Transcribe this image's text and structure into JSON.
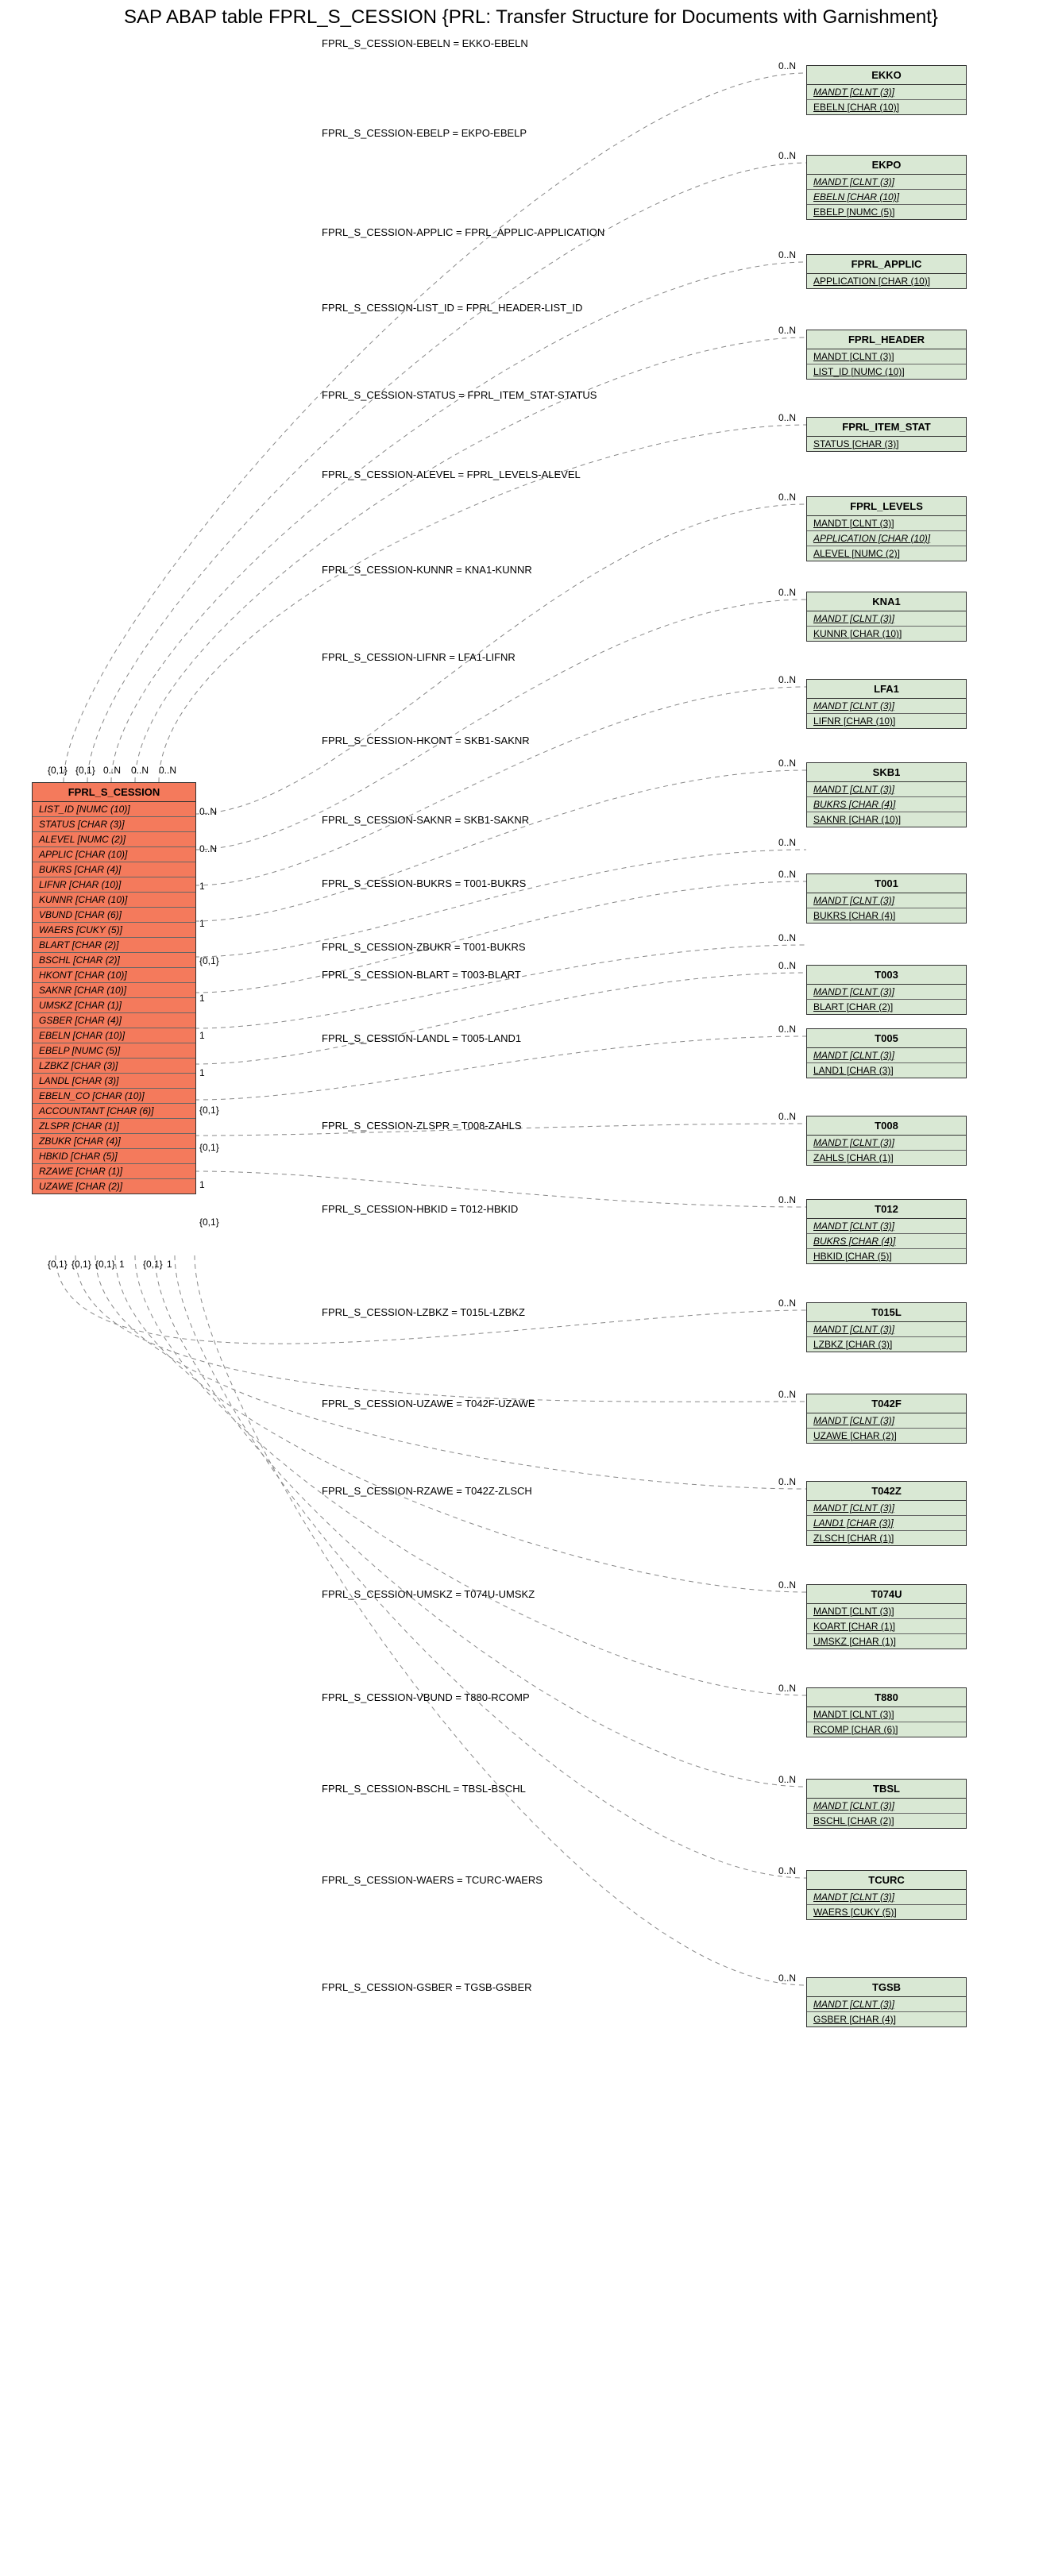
{
  "title": "SAP ABAP table FPRL_S_CESSION {PRL: Transfer Structure for Documents with Garnishment}",
  "main": {
    "name": "FPRL_S_CESSION",
    "fields": [
      {
        "t": "LIST_ID [NUMC (10)]",
        "i": true
      },
      {
        "t": "STATUS [CHAR (3)]",
        "i": true
      },
      {
        "t": "ALEVEL [NUMC (2)]",
        "i": true
      },
      {
        "t": "APPLIC [CHAR (10)]",
        "i": true
      },
      {
        "t": "BUKRS [CHAR (4)]",
        "i": true
      },
      {
        "t": "LIFNR [CHAR (10)]",
        "i": true
      },
      {
        "t": "KUNNR [CHAR (10)]",
        "i": true
      },
      {
        "t": "VBUND [CHAR (6)]",
        "i": true
      },
      {
        "t": "WAERS [CUKY (5)]",
        "i": true
      },
      {
        "t": "BLART [CHAR (2)]",
        "i": true
      },
      {
        "t": "BSCHL [CHAR (2)]",
        "i": true
      },
      {
        "t": "HKONT [CHAR (10)]",
        "i": true
      },
      {
        "t": "SAKNR [CHAR (10)]",
        "i": true
      },
      {
        "t": "UMSKZ [CHAR (1)]",
        "i": true
      },
      {
        "t": "GSBER [CHAR (4)]",
        "i": true
      },
      {
        "t": "EBELN [CHAR (10)]",
        "i": true
      },
      {
        "t": "EBELP [NUMC (5)]",
        "i": true
      },
      {
        "t": "LZBKZ [CHAR (3)]",
        "i": true
      },
      {
        "t": "LANDL [CHAR (3)]",
        "i": true
      },
      {
        "t": "EBELN_CO [CHAR (10)]",
        "i": true
      },
      {
        "t": "ACCOUNTANT [CHAR (6)]",
        "i": true
      },
      {
        "t": "ZLSPR [CHAR (1)]",
        "i": true
      },
      {
        "t": "ZBUKR [CHAR (4)]",
        "i": true
      },
      {
        "t": "HBKID [CHAR (5)]",
        "i": true
      },
      {
        "t": "RZAWE [CHAR (1)]",
        "i": true
      },
      {
        "t": "UZAWE [CHAR (2)]",
        "i": true
      }
    ],
    "cards_top": [
      "{0,1}",
      "{0,1}",
      "0..N",
      "0..N",
      "0..N"
    ],
    "cards_right_top": [
      "0..N",
      "0..N",
      "1",
      "1",
      "{0,1}",
      "1",
      "1",
      "1",
      "{0,1}",
      "{0,1}",
      "1",
      "{0,1}"
    ],
    "cards_bottom": [
      "{0,1}",
      "{0,1}",
      "{0,1}",
      "1",
      "{0,1}",
      "1"
    ]
  },
  "targets": [
    {
      "name": "EKKO",
      "fields": [
        {
          "t": "MANDT [CLNT (3)]",
          "u": true,
          "i": true
        },
        {
          "t": "EBELN [CHAR (10)]",
          "u": true
        }
      ],
      "join": "FPRL_S_CESSION-EBELN = EKKO-EBELN",
      "card": "0..N"
    },
    {
      "name": "EKPO",
      "fields": [
        {
          "t": "MANDT [CLNT (3)]",
          "u": true,
          "i": true
        },
        {
          "t": "EBELN [CHAR (10)]",
          "u": true,
          "i": true
        },
        {
          "t": "EBELP [NUMC (5)]",
          "u": true
        }
      ],
      "join": "FPRL_S_CESSION-EBELP = EKPO-EBELP",
      "card": "0..N"
    },
    {
      "name": "FPRL_APPLIC",
      "fields": [
        {
          "t": "APPLICATION [CHAR (10)]",
          "u": true
        }
      ],
      "join": "FPRL_S_CESSION-APPLIC = FPRL_APPLIC-APPLICATION",
      "card": "0..N"
    },
    {
      "name": "FPRL_HEADER",
      "fields": [
        {
          "t": "MANDT [CLNT (3)]",
          "u": true
        },
        {
          "t": "LIST_ID [NUMC (10)]",
          "u": true
        }
      ],
      "join": "FPRL_S_CESSION-LIST_ID = FPRL_HEADER-LIST_ID",
      "card": "0..N"
    },
    {
      "name": "FPRL_ITEM_STAT",
      "fields": [
        {
          "t": "STATUS [CHAR (3)]",
          "u": true
        }
      ],
      "join": "FPRL_S_CESSION-STATUS = FPRL_ITEM_STAT-STATUS",
      "card": "0..N"
    },
    {
      "name": "FPRL_LEVELS",
      "fields": [
        {
          "t": "MANDT [CLNT (3)]",
          "u": true
        },
        {
          "t": "APPLICATION [CHAR (10)]",
          "u": true,
          "i": true
        },
        {
          "t": "ALEVEL [NUMC (2)]",
          "u": true
        }
      ],
      "join": "FPRL_S_CESSION-ALEVEL = FPRL_LEVELS-ALEVEL",
      "card": "0..N"
    },
    {
      "name": "KNA1",
      "fields": [
        {
          "t": "MANDT [CLNT (3)]",
          "u": true,
          "i": true
        },
        {
          "t": "KUNNR [CHAR (10)]",
          "u": true
        }
      ],
      "join": "FPRL_S_CESSION-KUNNR = KNA1-KUNNR",
      "card": "0..N"
    },
    {
      "name": "LFA1",
      "fields": [
        {
          "t": "MANDT [CLNT (3)]",
          "u": true,
          "i": true
        },
        {
          "t": "LIFNR [CHAR (10)]",
          "u": true
        }
      ],
      "join": "FPRL_S_CESSION-LIFNR = LFA1-LIFNR",
      "card": "0..N"
    },
    {
      "name": "SKB1",
      "fields": [
        {
          "t": "MANDT [CLNT (3)]",
          "u": true,
          "i": true
        },
        {
          "t": "BUKRS [CHAR (4)]",
          "u": true,
          "i": true
        },
        {
          "t": "SAKNR [CHAR (10)]",
          "u": true
        }
      ],
      "join": "FPRL_S_CESSION-HKONT = SKB1-SAKNR",
      "card": "0..N"
    },
    {
      "name": "",
      "fields": [],
      "join": "FPRL_S_CESSION-SAKNR = SKB1-SAKNR",
      "card": "0..N"
    },
    {
      "name": "T001",
      "fields": [
        {
          "t": "MANDT [CLNT (3)]",
          "u": true,
          "i": true
        },
        {
          "t": "BUKRS [CHAR (4)]",
          "u": true
        }
      ],
      "join": "FPRL_S_CESSION-BUKRS = T001-BUKRS",
      "card": "0..N"
    },
    {
      "name": "",
      "fields": [],
      "join": "FPRL_S_CESSION-ZBUKR = T001-BUKRS",
      "card": "0..N"
    },
    {
      "name": "T003",
      "fields": [
        {
          "t": "MANDT [CLNT (3)]",
          "u": true,
          "i": true
        },
        {
          "t": "BLART [CHAR (2)]",
          "u": true
        }
      ],
      "join": "FPRL_S_CESSION-BLART = T003-BLART",
      "card": "0..N"
    },
    {
      "name": "T005",
      "fields": [
        {
          "t": "MANDT [CLNT (3)]",
          "u": true,
          "i": true
        },
        {
          "t": "LAND1 [CHAR (3)]",
          "u": true
        }
      ],
      "join": "FPRL_S_CESSION-LANDL = T005-LAND1",
      "card": "0..N"
    },
    {
      "name": "T008",
      "fields": [
        {
          "t": "MANDT [CLNT (3)]",
          "u": true,
          "i": true
        },
        {
          "t": "ZAHLS [CHAR (1)]",
          "u": true
        }
      ],
      "join": "FPRL_S_CESSION-ZLSPR = T008-ZAHLS",
      "card": "0..N"
    },
    {
      "name": "T012",
      "fields": [
        {
          "t": "MANDT [CLNT (3)]",
          "u": true,
          "i": true
        },
        {
          "t": "BUKRS [CHAR (4)]",
          "u": true,
          "i": true
        },
        {
          "t": "HBKID [CHAR (5)]",
          "u": true
        }
      ],
      "join": "FPRL_S_CESSION-HBKID = T012-HBKID",
      "card": "0..N"
    },
    {
      "name": "T015L",
      "fields": [
        {
          "t": "MANDT [CLNT (3)]",
          "u": true,
          "i": true
        },
        {
          "t": "LZBKZ [CHAR (3)]",
          "u": true
        }
      ],
      "join": "FPRL_S_CESSION-LZBKZ = T015L-LZBKZ",
      "card": "0..N"
    },
    {
      "name": "T042F",
      "fields": [
        {
          "t": "MANDT [CLNT (3)]",
          "u": true,
          "i": true
        },
        {
          "t": "UZAWE [CHAR (2)]",
          "u": true
        }
      ],
      "join": "FPRL_S_CESSION-UZAWE = T042F-UZAWE",
      "card": "0..N"
    },
    {
      "name": "T042Z",
      "fields": [
        {
          "t": "MANDT [CLNT (3)]",
          "u": true,
          "i": true
        },
        {
          "t": "LAND1 [CHAR (3)]",
          "u": true,
          "i": true
        },
        {
          "t": "ZLSCH [CHAR (1)]",
          "u": true
        }
      ],
      "join": "FPRL_S_CESSION-RZAWE = T042Z-ZLSCH",
      "card": "0..N"
    },
    {
      "name": "T074U",
      "fields": [
        {
          "t": "MANDT [CLNT (3)]",
          "u": true
        },
        {
          "t": "KOART [CHAR (1)]",
          "u": true
        },
        {
          "t": "UMSKZ [CHAR (1)]",
          "u": true
        }
      ],
      "join": "FPRL_S_CESSION-UMSKZ = T074U-UMSKZ",
      "card": "0..N"
    },
    {
      "name": "T880",
      "fields": [
        {
          "t": "MANDT [CLNT (3)]",
          "u": true
        },
        {
          "t": "RCOMP [CHAR (6)]",
          "u": true
        }
      ],
      "join": "FPRL_S_CESSION-VBUND = T880-RCOMP",
      "card": "0..N"
    },
    {
      "name": "TBSL",
      "fields": [
        {
          "t": "MANDT [CLNT (3)]",
          "u": true,
          "i": true
        },
        {
          "t": "BSCHL [CHAR (2)]",
          "u": true
        }
      ],
      "join": "FPRL_S_CESSION-BSCHL = TBSL-BSCHL",
      "card": "0..N"
    },
    {
      "name": "TCURC",
      "fields": [
        {
          "t": "MANDT [CLNT (3)]",
          "u": true,
          "i": true
        },
        {
          "t": "WAERS [CUKY (5)]",
          "u": true
        }
      ],
      "join": "FPRL_S_CESSION-WAERS = TCURC-WAERS",
      "card": "0..N"
    },
    {
      "name": "TGSB",
      "fields": [
        {
          "t": "MANDT [CLNT (3)]",
          "u": true,
          "i": true
        },
        {
          "t": "GSBER [CHAR (4)]",
          "u": true
        }
      ],
      "join": "FPRL_S_CESSION-GSBER = TGSB-GSBER",
      "card": "0..N"
    }
  ]
}
